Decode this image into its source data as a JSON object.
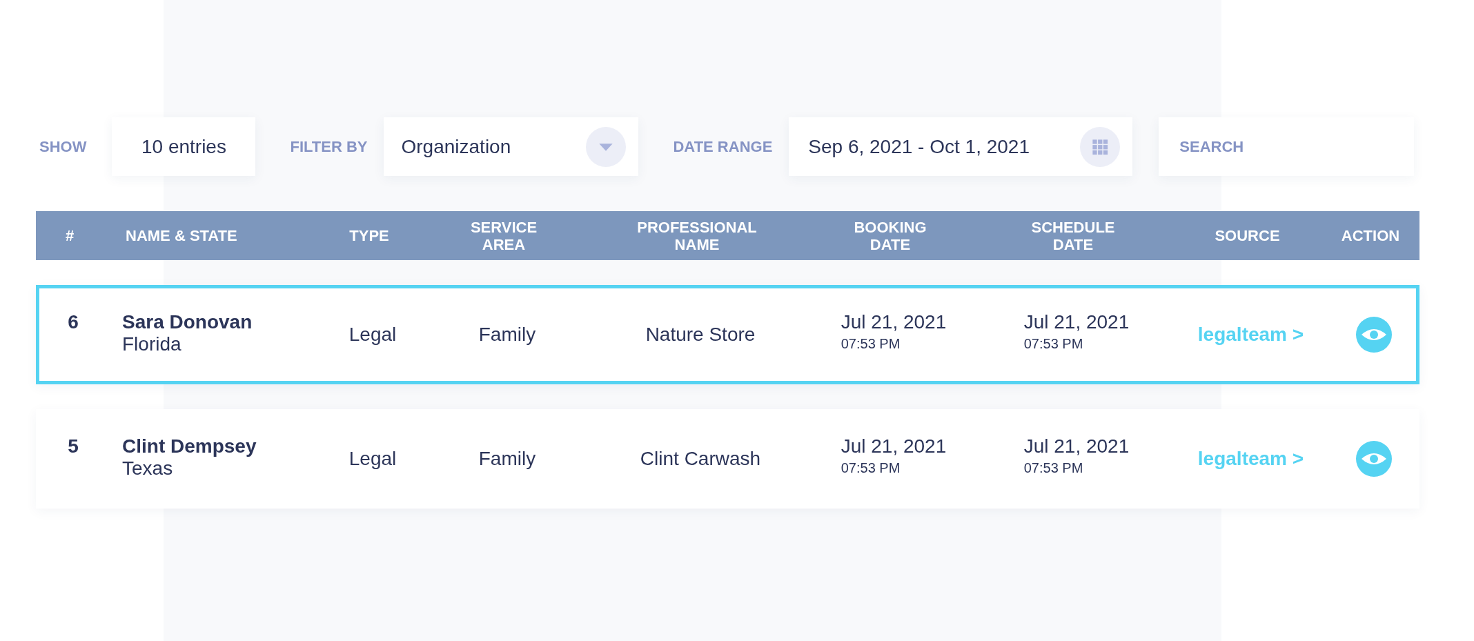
{
  "filters": {
    "show": {
      "label": "SHOW",
      "value": "10 entries"
    },
    "filter_by": {
      "label": "FILTER BY",
      "value": "Organization"
    },
    "date_range": {
      "label": "DATE RANGE",
      "value": "Sep 6, 2021 - Oct 1, 2021"
    },
    "search": {
      "placeholder": "SEARCH"
    }
  },
  "table": {
    "columns": [
      [
        "#"
      ],
      [
        "NAME & STATE"
      ],
      [
        "TYPE"
      ],
      [
        "SERVICE",
        "AREA"
      ],
      [
        "PROFESSIONAL",
        "NAME"
      ],
      [
        "BOOKING",
        "DATE"
      ],
      [
        "SCHEDULE",
        "DATE"
      ],
      [
        "SOURCE"
      ],
      [
        "ACTION"
      ]
    ],
    "rows": [
      {
        "selected": true,
        "number": "6",
        "name": "Sara Donovan",
        "state": "Florida",
        "type": "Legal",
        "service_area": "Family",
        "professional": "Nature Store",
        "booking_date": "Jul 21, 2021",
        "booking_time": "07:53 PM",
        "schedule_date": "Jul 21, 2021",
        "schedule_time": "07:53 PM",
        "source": "legalteam >"
      },
      {
        "selected": false,
        "number": "5",
        "name": "Clint Dempsey",
        "state": "Texas",
        "type": "Legal",
        "service_area": "Family",
        "professional": "Clint Carwash",
        "booking_date": "Jul 21, 2021",
        "booking_time": "07:53 PM",
        "schedule_date": "Jul 21, 2021",
        "schedule_time": "07:53 PM",
        "source": "legalteam >"
      }
    ]
  }
}
